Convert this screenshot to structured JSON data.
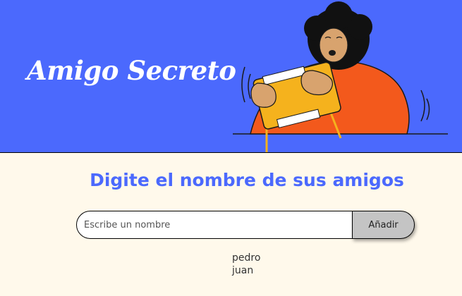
{
  "header": {
    "title": "Amigo Secreto",
    "illustration": "person-holding-gift-illustration",
    "background_color": "#4b69fd"
  },
  "main": {
    "subtitle": "Digite el nombre de sus amigos",
    "input": {
      "placeholder": "Escribe un nombre",
      "value": ""
    },
    "add_button_label": "Añadir",
    "friends": [
      "pedro",
      "juan"
    ]
  }
}
